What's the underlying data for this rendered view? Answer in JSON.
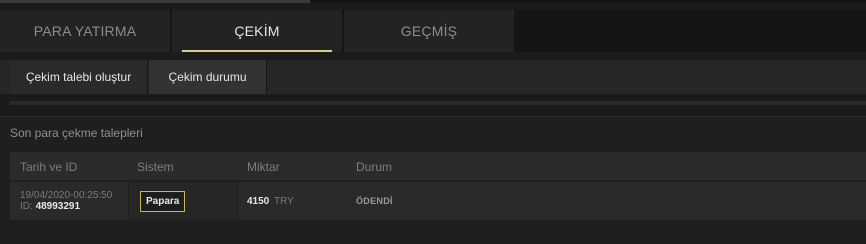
{
  "tabs": {
    "deposit": "PARA YATIRMA",
    "withdraw": "ÇEKİM",
    "history": "GEÇMİŞ"
  },
  "subtabs": {
    "create": "Çekim talebi oluştur",
    "status": "Çekim durumu"
  },
  "panel": {
    "title": "Son para çekme talepleri"
  },
  "table": {
    "headers": {
      "date": "Tarih ve ID",
      "system": "Sistem",
      "amount": "Miktar",
      "status": "Durum"
    },
    "rows": [
      {
        "date": "19/04/2020-00:25:50",
        "id_label": "ID:",
        "id": "48993291",
        "system": "Papara",
        "amount": "4150",
        "currency": "TRY",
        "status": "ÖDENDİ"
      }
    ]
  },
  "colors": {
    "accent": "#d8cf8a",
    "badge_border": "#c9b45e"
  }
}
